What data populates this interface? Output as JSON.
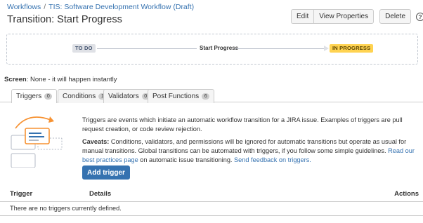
{
  "breadcrumb": {
    "items": [
      "Workflows",
      "TIS: Software Development Workflow (Draft)"
    ],
    "separator": "/"
  },
  "page_title": "Transition: Start Progress",
  "toolbar": {
    "edit_label": "Edit",
    "view_properties_label": "View Properties",
    "delete_label": "Delete",
    "help_icon": "?"
  },
  "diagram": {
    "from_status": "TO DO",
    "transition": "Start Progress",
    "to_status": "IN PROGRESS"
  },
  "screen": {
    "label": "Screen",
    "value": ": None - it will happen instantly"
  },
  "tabs": [
    {
      "label": "Triggers",
      "count": "0",
      "active": true
    },
    {
      "label": "Conditions",
      "count": "1",
      "active": false
    },
    {
      "label": "Validators",
      "count": "0",
      "active": false
    },
    {
      "label": "Post Functions",
      "count": "6",
      "active": false
    }
  ],
  "description": {
    "intro": "Triggers are events which initiate an automatic workflow transition for a JIRA issue. Examples of triggers are pull request creation, or code review rejection.",
    "caveats_label": "Caveats:",
    "caveats_text": " Conditions, validators, and permissions will be ignored for automatic transitions but operate as usual for manual transitions. Global transitions can be automated with triggers, if you follow some simple guidelines. ",
    "best_practices_link": "Read our best practices page",
    "caveats_tail": " on automatic issue transitioning. ",
    "feedback_link": "Send feedback on triggers."
  },
  "add_trigger_label": "Add trigger",
  "table": {
    "columns": [
      "Trigger",
      "Details",
      "Actions"
    ],
    "empty_message": "There are no triggers currently defined."
  },
  "colors": {
    "link": "#3572b0",
    "primary_button": "#3572b0",
    "todo_lozenge": "#dfe1e6",
    "in_progress_lozenge": "#ffd351",
    "illustration_orange": "#f79232"
  },
  "icons": [
    "help-icon",
    "transition-illustration"
  ]
}
